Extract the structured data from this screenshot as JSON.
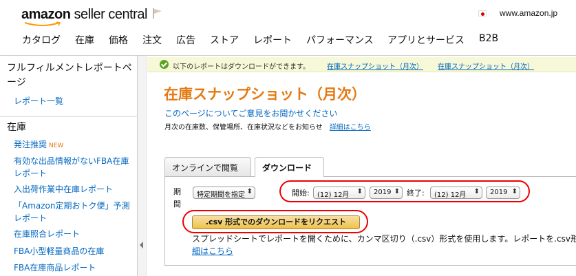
{
  "header": {
    "logo_bold": "amazon",
    "logo_light": " seller central",
    "domain": "www.amazon.jp"
  },
  "nav": [
    "カタログ",
    "在庫",
    "価格",
    "注文",
    "広告",
    "ストア",
    "レポート",
    "パフォーマンス",
    "アプリとサービス",
    "B2B"
  ],
  "sidebar": {
    "title": "フルフィルメントレポートページ",
    "report_list_link": "レポート一覧",
    "section_inventory": "在庫",
    "items": [
      {
        "label": "発注推奨",
        "badge": "NEW"
      },
      {
        "label": "有効な出品情報がないFBA在庫レポート"
      },
      {
        "label": "入出荷作業中在庫レポート"
      },
      {
        "label": "「Amazon定期おトク便」予測レポート"
      },
      {
        "label": "在庫照合レポート"
      },
      {
        "label": "FBA小型軽量商品の在庫"
      },
      {
        "label": "FBA在庫商品レポート"
      }
    ]
  },
  "banner": {
    "message": "以下のレポートはダウンロードができます。",
    "link1": "在庫スナップショット（月次）",
    "link2": "在庫スナップショット（月次）"
  },
  "main": {
    "title": "在庫スナップショット（月次）",
    "feedback_link": "このページについてご意見をお聞かせください",
    "description": "月次の在庫数、保管場所、在庫状況などをお知らせ",
    "details_link": "詳細はこちら",
    "tabs": [
      "オンラインで閲覧",
      "ダウンロード"
    ],
    "active_tab": "ダウンロード",
    "period_label": "期間",
    "period_select": "特定期間を指定",
    "start_label": "開始:",
    "start_month": "(12) 12月",
    "start_year": "2019",
    "end_label": "終了:",
    "end_month": "(12) 12月",
    "end_year": "2019",
    "csv_button": ".csv 形式でのダウンロードをリクエスト",
    "csv_description": "スプレッドシートでレポートを開くために、カンマ区切り（.csv）形式を使用します。レポートを.csv形",
    "csv_details_link": "細はこちら"
  },
  "colors": {
    "accent": "#e47911",
    "link": "#0066c0",
    "highlight": "#ee0000",
    "button": "#f0c14b"
  }
}
